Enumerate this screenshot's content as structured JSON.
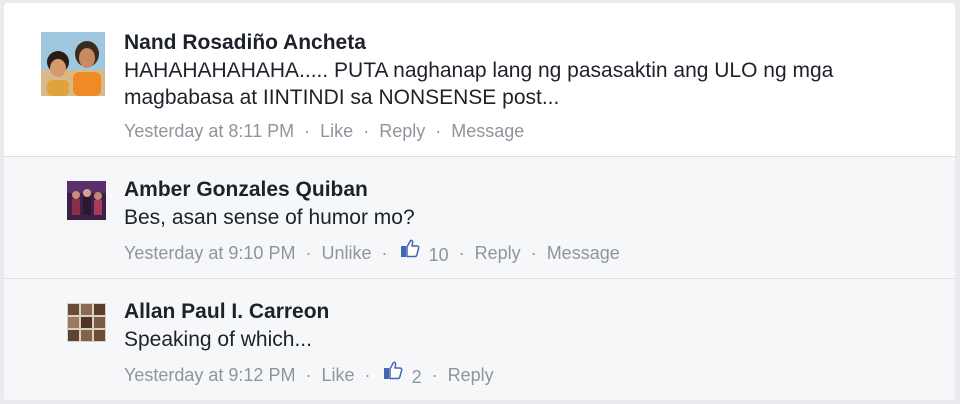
{
  "comments": [
    {
      "author": "Nand Rosadiño Ancheta",
      "text": "HAHAHAHAHAHA..... PUTA naghanap lang ng pasasaktin ang ULO ng mga magbabasa at IINTINDI sa NONSENSE post...",
      "time": "Yesterday at 8:11 PM",
      "like_action": "Like",
      "reply_label": "Reply",
      "message_label": "Message"
    },
    {
      "author": "Amber Gonzales Quiban",
      "text": "Bes, asan sense of humor mo?",
      "time": "Yesterday at 9:10 PM",
      "like_action": "Unlike",
      "like_count": "10",
      "reply_label": "Reply",
      "message_label": "Message"
    },
    {
      "author": "Allan Paul I. Carreon",
      "text": "Speaking of which...",
      "time": "Yesterday at 9:12 PM",
      "like_action": "Like",
      "like_count": "2",
      "reply_label": "Reply"
    }
  ],
  "separator": "·",
  "colors": {
    "meta_gray": "#90949c",
    "like_blue": "#4267b2",
    "reply_bg": "#f6f7f9"
  }
}
